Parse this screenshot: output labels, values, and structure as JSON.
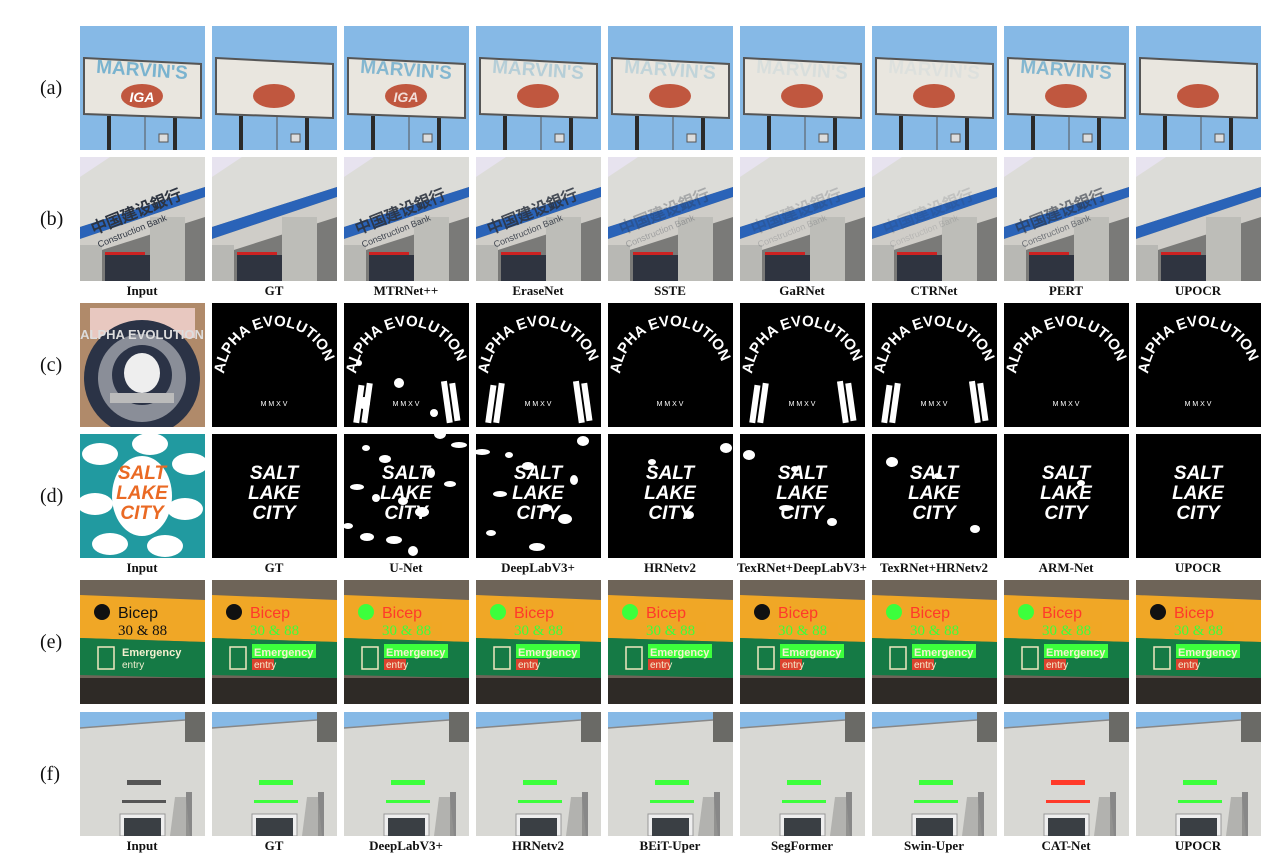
{
  "figure": {
    "rows": [
      {
        "label": "(a)",
        "scene": "sign"
      },
      {
        "label": "(b)",
        "scene": "bank"
      },
      {
        "label": "(c)",
        "scene": "alpha"
      },
      {
        "label": "(d)",
        "scene": "salt"
      },
      {
        "label": "(e)",
        "scene": "airport"
      },
      {
        "label": "(f)",
        "scene": "wall"
      }
    ],
    "caption_groups": [
      [
        "Input",
        "GT",
        "MTRNet++",
        "EraseNet",
        "SSTE",
        "GaRNet",
        "CTRNet",
        "PERT",
        "UPOCR"
      ],
      [
        "Input",
        "GT",
        "U-Net",
        "DeepLabV3+",
        "HRNetv2",
        "TexRNet+DeepLabV3+",
        "TexRNet+HRNetv2",
        "ARM-Net",
        "UPOCR"
      ],
      [
        "Input",
        "GT",
        "DeepLabV3+",
        "HRNetv2",
        "BEiT-Uper",
        "SegFormer",
        "Swin-Uper",
        "CAT-Net",
        "UPOCR"
      ]
    ],
    "image_text": {
      "sign_top": "MARVIN'S",
      "sign_oval": "IGA",
      "bank_en": "Construction Bank",
      "alpha": "ALPHA EVOLUTION",
      "alpha_sub": "M M X V",
      "salt": [
        "SALT",
        "LAKE",
        "CITY"
      ],
      "airport_top": "Bicep",
      "airport_num": "30 & 88",
      "airport_green": "Emergency",
      "airport_green2": "entry"
    },
    "colors": {
      "sky": "#86b9e6",
      "sign_board": "#e9e6df",
      "sign_oval": "#c0573f",
      "sign_letters": "#7ab3cf",
      "bank_blue": "#2a63b8",
      "teal": "#219aa0",
      "salt_orange": "#ea6a24",
      "airport_yellow": "#f0a726",
      "airport_green": "#157a45",
      "hl_green": "#3cff3c",
      "hl_red": "#ff3a2a",
      "wall": "#d8d8d4"
    }
  }
}
